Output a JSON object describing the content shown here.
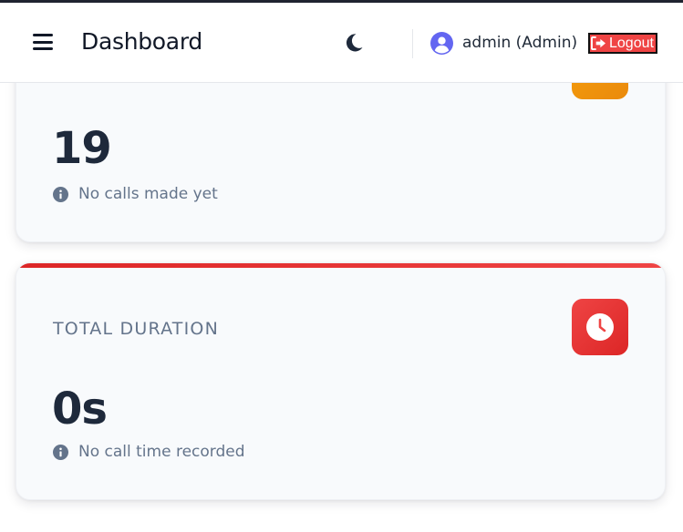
{
  "header": {
    "title": "Dashboard",
    "user_label": "admin (Admin)",
    "logout_label": "Logout",
    "icons": [
      "menu-icon",
      "moon-icon",
      "user-circle-icon",
      "sign-out-icon"
    ]
  },
  "cards": [
    {
      "label": "",
      "value": "19",
      "subtext": "No calls made yet",
      "icon_color": "#f59e0b"
    },
    {
      "label": "TOTAL DURATION",
      "value": "0s",
      "subtext": "No call time recorded",
      "icon": "clock-icon",
      "accent_color": "#ef4444",
      "icon_color": "#ef4444"
    }
  ],
  "colors": {
    "text_dark": "#1e293b",
    "text_muted": "#64748b",
    "danger": "#ef4444",
    "warning": "#f59e0b",
    "user_icon": "#6366f1"
  }
}
